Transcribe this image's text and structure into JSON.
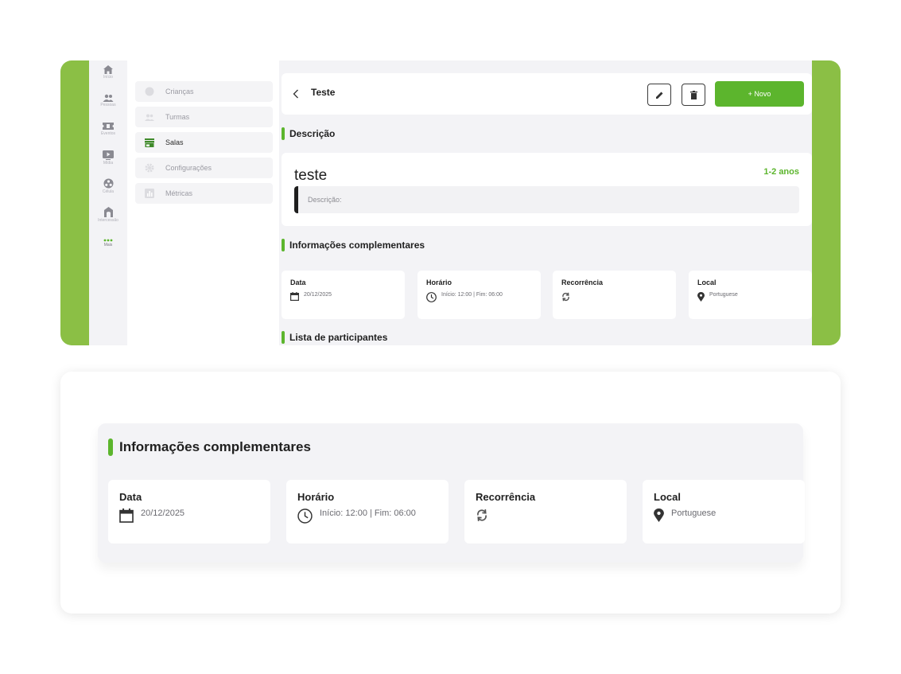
{
  "rail": {
    "items": [
      {
        "label": "Início",
        "icon": "home-icon"
      },
      {
        "label": "Pessoas",
        "icon": "people-icon"
      },
      {
        "label": "Eventos",
        "icon": "ticket-icon"
      },
      {
        "label": "Mídia",
        "icon": "media-icon"
      },
      {
        "label": "Célula",
        "icon": "cell-icon"
      },
      {
        "label": "Intercessão",
        "icon": "intercession-icon"
      },
      {
        "label": "Mais",
        "icon": "more-icon"
      }
    ]
  },
  "subnav": {
    "items": [
      {
        "label": "Crianças",
        "icon": "child-icon"
      },
      {
        "label": "Turmas",
        "icon": "group-icon"
      },
      {
        "label": "Salas",
        "icon": "store-icon",
        "active": true
      },
      {
        "label": "Configurações",
        "icon": "gear-icon"
      },
      {
        "label": "Métricas",
        "icon": "chart-icon"
      }
    ]
  },
  "header": {
    "title": "Teste",
    "new_label": "+ Novo"
  },
  "sections": {
    "description": "Descrição",
    "info": "Informações complementares",
    "participants": "Lista de participantes"
  },
  "description_card": {
    "name": "teste",
    "age_range": "1-2 anos",
    "placeholder": "Descrição:"
  },
  "info_cards": {
    "date": {
      "label": "Data",
      "value": "20/12/2025"
    },
    "time": {
      "label": "Horário",
      "value": "Início: 12:00 | Fim: 06:00"
    },
    "recurrence": {
      "label": "Recorrência"
    },
    "location": {
      "label": "Local",
      "value": "Portuguese"
    }
  },
  "zoom": {
    "title": "Informações complementares"
  },
  "colors": {
    "accent": "#5cb52d",
    "frame": "#8bbf45"
  }
}
